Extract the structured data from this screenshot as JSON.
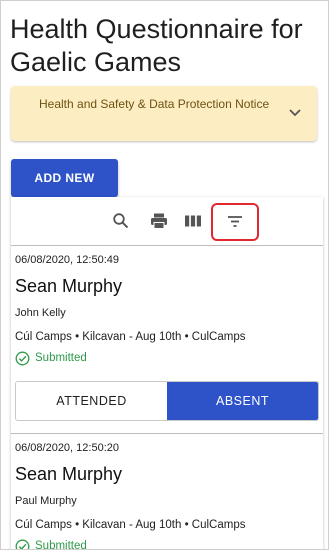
{
  "page": {
    "title": "Health Questionnaire for Gaelic Games"
  },
  "notice": {
    "label": "Health and Safety & Data Protection Notice",
    "icon": "chevron-down-icon"
  },
  "actions": {
    "add_new_label": "ADD NEW"
  },
  "toolbar": {
    "icons": [
      "search-icon",
      "print-icon",
      "columns-icon",
      "filter-icon"
    ],
    "highlighted": "filter-icon",
    "highlight_color": "#e0282e"
  },
  "entries": [
    {
      "timestamp": "06/08/2020, 12:50:49",
      "name": "Sean Murphy",
      "person": "John Kelly",
      "camp": "Cúl Camps • Kilcavan - Aug 10th • CulCamps",
      "status": "Submitted",
      "attendance": {
        "attended_label": "ATTENDED",
        "absent_label": "ABSENT",
        "selected": "ABSENT"
      }
    },
    {
      "timestamp": "06/08/2020, 12:50:20",
      "name": "Sean Murphy",
      "person": "Paul Murphy",
      "camp": "Cúl Camps • Kilcavan - Aug 10th • CulCamps",
      "status": "Submitted"
    }
  ],
  "colors": {
    "accent": "#2e52c8",
    "notice_bg": "#fcedc3",
    "status_green": "#2e9a4a"
  }
}
